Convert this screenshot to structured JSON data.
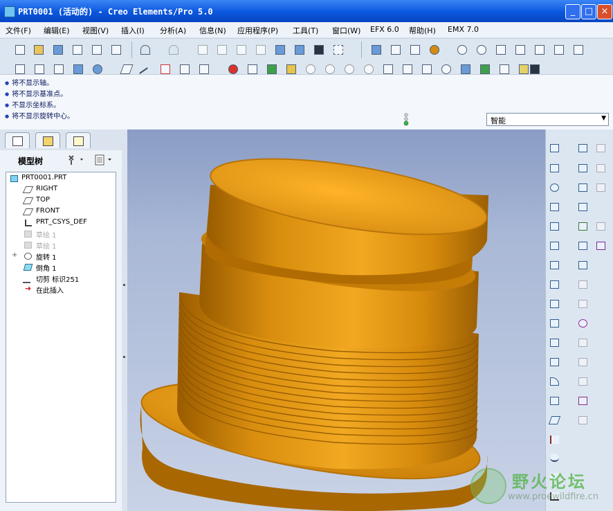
{
  "window": {
    "title": "PRT0001 (活动的) - Creo Elements/Pro 5.0",
    "minimize": "_",
    "maximize": "□",
    "close": "×"
  },
  "menu": [
    "文件(F)",
    "编辑(E)",
    "视图(V)",
    "插入(I)",
    "分析(A)",
    "信息(N)",
    "应用程序(P)",
    "工具(T)",
    "窗口(W)",
    "EFX 6.0",
    "帮助(H)",
    "EMX 7.0"
  ],
  "messages": [
    "将不显示轴。",
    "将不显示基准点。",
    "不显示坐标系。",
    "将不显示旋转中心。"
  ],
  "filter": {
    "value": "智能"
  },
  "model_tree": {
    "title": "模型树",
    "items": [
      {
        "label": "PRT0001.PRT",
        "icon": "part-icon",
        "dim": false
      },
      {
        "label": "RIGHT",
        "icon": "datum-plane-icon",
        "dim": false
      },
      {
        "label": "TOP",
        "icon": "datum-plane-icon",
        "dim": false
      },
      {
        "label": "FRONT",
        "icon": "datum-plane-icon",
        "dim": false
      },
      {
        "label": "PRT_CSYS_DEF",
        "icon": "csys-icon",
        "dim": false
      },
      {
        "label": "草绘 1",
        "icon": "sketch-icon",
        "dim": true
      },
      {
        "label": "草绘 1",
        "icon": "sketch-icon",
        "dim": true
      },
      {
        "label": "旋转 1",
        "icon": "revolve-icon",
        "dim": false
      },
      {
        "label": "倒角 1",
        "icon": "chamfer-icon",
        "dim": false
      },
      {
        "label": "切剪 标识251",
        "icon": "cut-icon",
        "dim": false
      },
      {
        "label": "在此插入",
        "icon": "insert-here-icon",
        "dim": false
      }
    ]
  },
  "watermark": {
    "brand": "野火论坛",
    "url": "www.proewildfire.cn"
  },
  "colors": {
    "titlebar": "#0a56de",
    "model": "#d48c10",
    "viewport_top": "#8a9cc5",
    "viewport_bottom": "#c9d3e7"
  }
}
